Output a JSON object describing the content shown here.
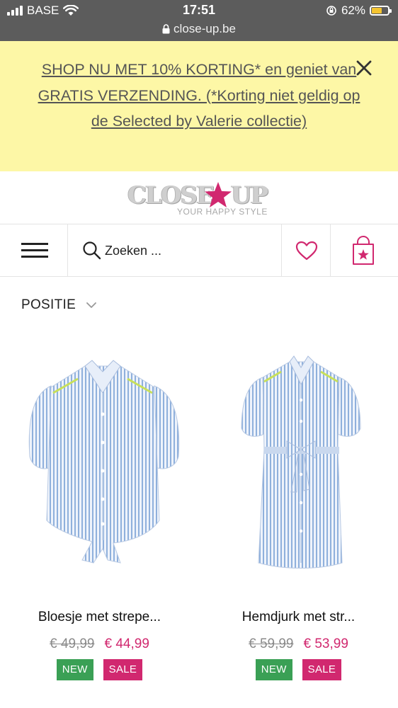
{
  "status_bar": {
    "carrier": "BASE",
    "time": "17:51",
    "battery": "62%",
    "battery_level": 0.62,
    "url": "close-up.be"
  },
  "promo": {
    "text": "SHOP NU MET 10% KORTING* en geniet van GRATIS VERZENDING. (*Korting niet geldig op de Selected by Valerie collectie)",
    "close_icon": "close-icon"
  },
  "brand": {
    "logo_text_left": "CLOSE",
    "logo_text_right": "UP",
    "tagline": "YOUR HAPPY STYLE",
    "accent_color": "#d1286f"
  },
  "nav": {
    "menu_icon": "hamburger-menu-icon",
    "search_placeholder": "Zoeken ...",
    "wishlist_icon": "heart-icon",
    "cart_icon": "shopping-bag-icon"
  },
  "sort": {
    "label": "POSITIE"
  },
  "products": [
    {
      "name": "Bloesje met strepe...",
      "old_price": "€ 49,99",
      "new_price": "€ 44,99",
      "badges": [
        "NEW",
        "SALE"
      ]
    },
    {
      "name": "Hemdjurk met str...",
      "old_price": "€ 59,99",
      "new_price": "€ 53,99",
      "badges": [
        "NEW",
        "SALE"
      ]
    }
  ],
  "colors": {
    "status_bar_bg": "#5c5c5c",
    "promo_bg": "#fdf7a6",
    "new_badge": "#3aa055",
    "sale_badge": "#d1286f",
    "old_price": "#8a8a8a"
  }
}
